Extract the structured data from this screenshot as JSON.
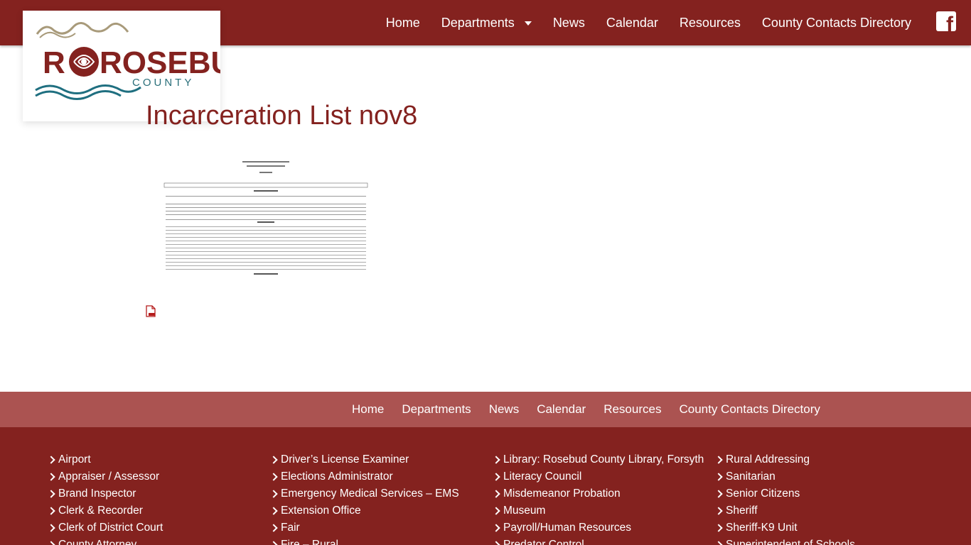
{
  "brand": {
    "name": "ROSEBUD",
    "subtitle": "COUNTY",
    "colors": {
      "primary": "#84221f",
      "secondary": "#ab5351",
      "wave": "#1f6f80",
      "hills": "#a89a7a"
    }
  },
  "nav": {
    "items": [
      "Home",
      "Departments",
      "News",
      "Calendar",
      "Resources",
      "County Contacts Directory"
    ],
    "social_icon": "facebook-icon"
  },
  "page": {
    "title": "Incarceration List nov8",
    "attachment_icon": "pdf-file-icon"
  },
  "footer_nav": {
    "items": [
      "Home",
      "Departments",
      "News",
      "Calendar",
      "Resources",
      "County Contacts Directory"
    ]
  },
  "footer_links": {
    "col1": [
      "Airport",
      "Appraiser / Assessor",
      "Brand Inspector",
      "Clerk & Recorder",
      "Clerk of District Court",
      "County Attorney"
    ],
    "col2": [
      "Driver’s License Examiner",
      "Elections Administrator",
      "Emergency Medical Services – EMS",
      "Extension Office",
      "Fair",
      "Fire – Rural"
    ],
    "col3": [
      "Library: Rosebud County Library, Forsyth",
      "Literacy Council",
      "Misdemeanor Probation",
      "Museum",
      "Payroll/Human Resources",
      "Predator Control"
    ],
    "col4": [
      "Rural Addressing",
      "Sanitarian",
      "Senior Citizens",
      "Sheriff",
      "Sheriff-K9 Unit",
      "Superintendent of Schools"
    ]
  }
}
